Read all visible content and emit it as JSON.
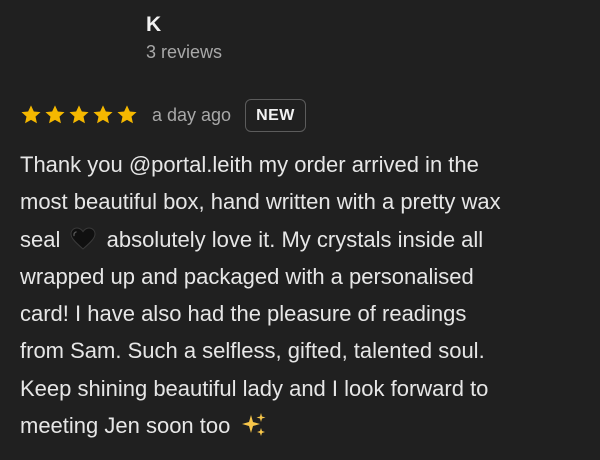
{
  "reviewer": {
    "name": "K",
    "review_count": "3 reviews"
  },
  "review": {
    "rating": 5,
    "rating_max": 5,
    "time_ago": "a day ago",
    "badge": "NEW",
    "lines": [
      {
        "text": "Thank you @portal.leith my order arrived in the"
      },
      {
        "text": "most beautiful box, hand written with a pretty wax"
      },
      {
        "before": "seal",
        "emoji": "black-heart-icon",
        "after": "absolutely love it. My crystals inside all"
      },
      {
        "text": "wrapped up and packaged with a personalised"
      },
      {
        "text": "card! I have also had the pleasure of readings"
      },
      {
        "text": "from Sam. Such a selfless, gifted, talented soul."
      },
      {
        "text": "Keep shining beautiful lady and I look forward to"
      },
      {
        "before": "meeting Jen soon too",
        "emoji": "sparkles-icon"
      }
    ]
  },
  "colors": {
    "background": "#202020",
    "star": "#F5B800",
    "text": "#E6E6E6",
    "muted": "#A8A8A8"
  }
}
